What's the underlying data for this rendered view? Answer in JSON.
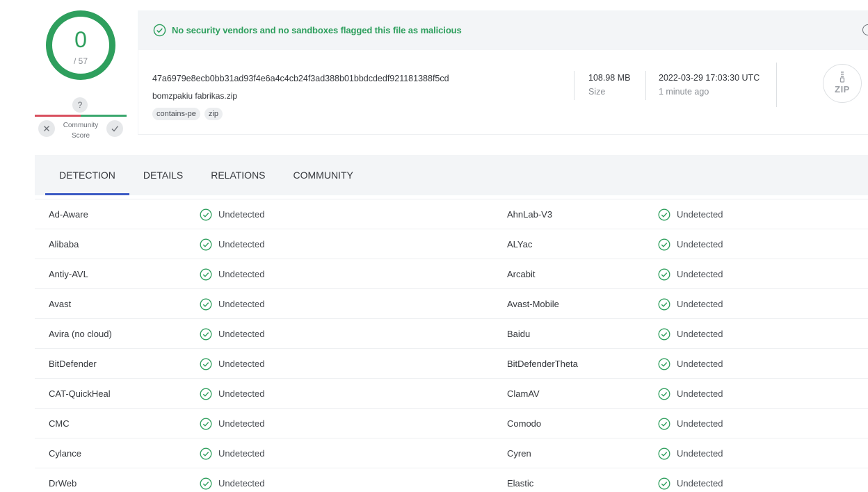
{
  "score": {
    "detected": "0",
    "total": "/ 57"
  },
  "community": {
    "question": "?",
    "label_line1": "Community",
    "label_line2": "Score"
  },
  "banner": {
    "text": "No security vendors and no sandboxes flagged this file as malicious"
  },
  "file": {
    "hash": "47a6979e8ecb0bb31ad93f4e6a4c4cb24f3ad388b01bbdcdedf921181388f5cd",
    "name": "bomzpakiu fabrikas.zip",
    "tags": [
      "contains-pe",
      "zip"
    ],
    "size": "108.98 MB",
    "size_label": "Size",
    "date": "2022-03-29 17:03:30 UTC",
    "date_label": "1 minute ago",
    "type_badge": "ZIP"
  },
  "tabs": [
    {
      "label": "DETECTION",
      "active": true
    },
    {
      "label": "DETAILS",
      "active": false
    },
    {
      "label": "RELATIONS",
      "active": false
    },
    {
      "label": "COMMUNITY",
      "active": false
    }
  ],
  "detections": [
    {
      "left": "Ad-Aware",
      "left_status": "Undetected",
      "right": "AhnLab-V3",
      "right_status": "Undetected"
    },
    {
      "left": "Alibaba",
      "left_status": "Undetected",
      "right": "ALYac",
      "right_status": "Undetected"
    },
    {
      "left": "Antiy-AVL",
      "left_status": "Undetected",
      "right": "Arcabit",
      "right_status": "Undetected"
    },
    {
      "left": "Avast",
      "left_status": "Undetected",
      "right": "Avast-Mobile",
      "right_status": "Undetected"
    },
    {
      "left": "Avira (no cloud)",
      "left_status": "Undetected",
      "right": "Baidu",
      "right_status": "Undetected"
    },
    {
      "left": "BitDefender",
      "left_status": "Undetected",
      "right": "BitDefenderTheta",
      "right_status": "Undetected"
    },
    {
      "left": "CAT-QuickHeal",
      "left_status": "Undetected",
      "right": "ClamAV",
      "right_status": "Undetected"
    },
    {
      "left": "CMC",
      "left_status": "Undetected",
      "right": "Comodo",
      "right_status": "Undetected"
    },
    {
      "left": "Cylance",
      "left_status": "Undetected",
      "right": "Cyren",
      "right_status": "Undetected"
    },
    {
      "left": "DrWeb",
      "left_status": "Undetected",
      "right": "Elastic",
      "right_status": "Undetected"
    }
  ],
  "colors": {
    "accent_green": "#2e9f5d",
    "tab_underline": "#3b5ac4",
    "negative": "#d8505f"
  }
}
